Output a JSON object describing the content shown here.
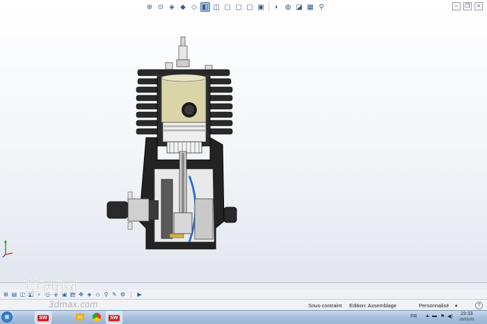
{
  "heads_up_toolbar": {
    "buttons": [
      {
        "name": "zoom-to-fit-icon",
        "glyph": "⊕"
      },
      {
        "name": "zoom-to-area-icon",
        "glyph": "⊙"
      },
      {
        "name": "previous-view-icon",
        "glyph": "◈"
      },
      {
        "name": "section-view-icon",
        "glyph": "◧"
      },
      {
        "name": "view-orientation-icon",
        "glyph": "◫"
      },
      {
        "name": "display-style-icon",
        "glyph": "▣"
      },
      {
        "name": "hide-show-items-icon",
        "glyph": "▤"
      },
      {
        "name": "edit-appearance-icon",
        "glyph": "◍"
      },
      {
        "name": "apply-scene-icon",
        "glyph": "◪"
      },
      {
        "name": "view-settings-icon",
        "glyph": "⚙"
      }
    ]
  },
  "status_bar": {
    "constraint": "Sous-contraint",
    "mode": "Edition: Assemblage",
    "customize": "Personnalisé"
  },
  "taskbar": {
    "language": "FR",
    "time": "19:33",
    "date": "20/01/20"
  },
  "watermark": {
    "text": "莫西网",
    "subtext": "3dmax.com"
  },
  "colors": {
    "cylinder_sleeve": "#d9d5a8",
    "engine_body": "#1e1e1e",
    "crank_disc": "#c9c9c9",
    "bearing": "#d4b04a",
    "accent_blue": "#2a6fd0",
    "taskbar": "#a9c0dc"
  }
}
